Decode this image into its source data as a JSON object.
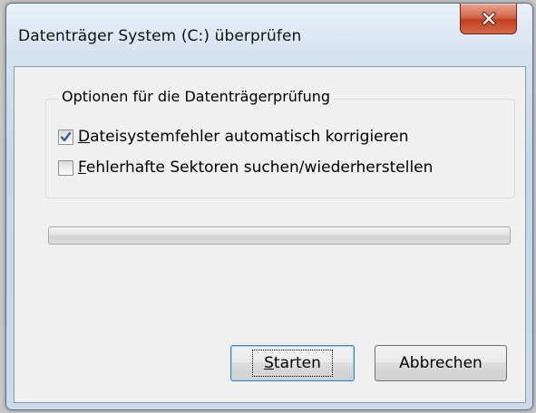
{
  "window": {
    "title": "Datenträger System (C:) überprüfen",
    "close_icon": "close-x-icon"
  },
  "options": {
    "group_title": "Optionen für die Datenträgerprüfung",
    "checkboxes": [
      {
        "mnemonic": "D",
        "rest": "ateisystemfehler automatisch korrigieren",
        "checked": true
      },
      {
        "mnemonic": "F",
        "rest": "ehlerhafte Sektoren suchen/wiederherstellen",
        "checked": false
      }
    ]
  },
  "progress": {
    "value": 0
  },
  "buttons": {
    "start": {
      "mnemonic": "S",
      "rest": "tarten"
    },
    "cancel": "Abbrechen"
  },
  "colors": {
    "close_button": "#c7452a",
    "checkmark": "#3a5a9c",
    "default_button_border": "#3c7fb1"
  }
}
